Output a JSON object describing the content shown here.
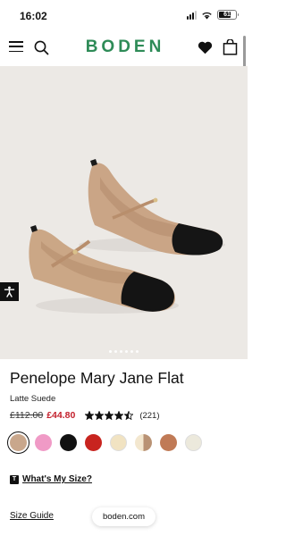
{
  "status_bar": {
    "time": "16:02",
    "battery": "61"
  },
  "header": {
    "logo": "BODEN",
    "icons": [
      "menu-icon",
      "search-icon",
      "heart-icon",
      "bag-icon"
    ],
    "brand_color": "#2e8b57"
  },
  "product": {
    "title": "Penelope Mary Jane Flat",
    "colour": "Latte Suede",
    "old_price": "£112.00",
    "sale_price": "£44.80",
    "rating": 4.5,
    "rating_max": 5,
    "review_count": "(221)",
    "image_count": 6,
    "active_image": 1,
    "swatches": [
      {
        "color": "#c9a78c",
        "selected": true
      },
      {
        "color": "#f09ac6",
        "selected": false
      },
      {
        "color": "#111111",
        "selected": false
      },
      {
        "color": "#c8241f",
        "selected": false
      },
      {
        "color": "#f1e3c2",
        "selected": false
      },
      {
        "color": "#c8a889",
        "selected": false
      },
      {
        "color": "#c07a56",
        "selected": false
      },
      {
        "color": "#ece9dc",
        "selected": false
      }
    ]
  },
  "size_help": {
    "badge": "T",
    "label": "What's My Size?"
  },
  "size_guide": "Size Guide",
  "browser": {
    "url": "boden.com"
  },
  "colors": {
    "sale": "#c3202c",
    "image_bg": "#ece9e5"
  }
}
